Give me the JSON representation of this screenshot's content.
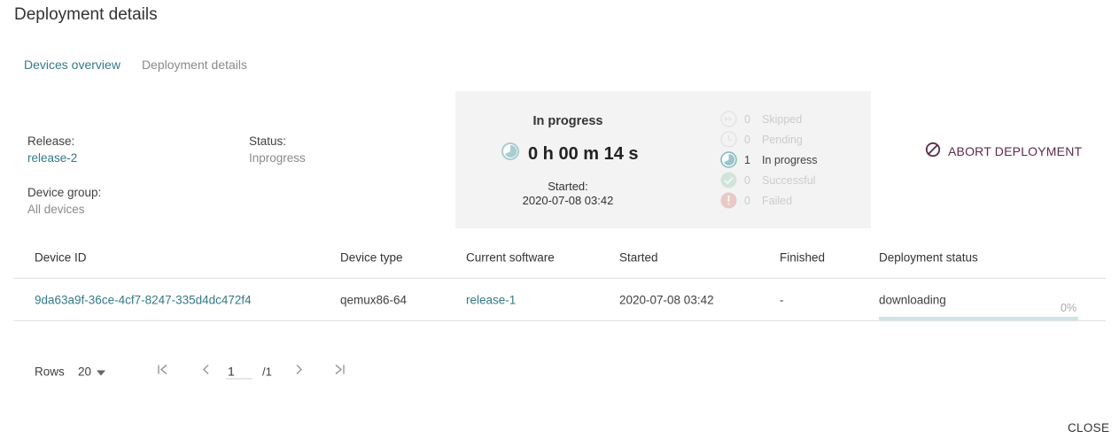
{
  "dialog": {
    "title": "Deployment details",
    "close_label": "CLOSE"
  },
  "tabs": [
    {
      "label": "Devices overview",
      "active": true
    },
    {
      "label": "Deployment details",
      "active": false
    }
  ],
  "summary": {
    "release_label": "Release:",
    "release_value": "release-2",
    "status_label": "Status:",
    "status_value": "Inprogress",
    "group_label": "Device group:",
    "group_value": "All devices"
  },
  "progress": {
    "title": "In progress",
    "timer": "0 h 00 m 14 s",
    "started_label": "Started:",
    "started_value": "2020-07-08 03:42",
    "phases": [
      {
        "count": "0",
        "label": "Skipped",
        "icon": "skipped-icon",
        "active": false,
        "color": "#b0b0b0"
      },
      {
        "count": "0",
        "label": "Pending",
        "icon": "pending-icon",
        "active": false,
        "color": "#b0b0b0"
      },
      {
        "count": "1",
        "label": "In progress",
        "icon": "in-progress-icon",
        "active": true,
        "color": "#7fb7bd"
      },
      {
        "count": "0",
        "label": "Successful",
        "icon": "check-icon",
        "active": false,
        "color": "#5cb08a"
      },
      {
        "count": "0",
        "label": "Failed",
        "icon": "alert-icon",
        "active": false,
        "color": "#c0392b"
      }
    ]
  },
  "abort": {
    "label": "ABORT DEPLOYMENT",
    "icon": "block-icon",
    "color": "#5b2a4a"
  },
  "table": {
    "columns": [
      "Device ID",
      "Device type",
      "Current software",
      "Started",
      "Finished",
      "Deployment status"
    ],
    "rows": [
      {
        "device_id": "9da63a9f-36ce-4cf7-8247-335d4dc472f4",
        "device_type": "qemux86-64",
        "current_software": "release-1",
        "started": "2020-07-08 03:42",
        "finished": "-",
        "status": "downloading",
        "percent_label": "0%",
        "progress_fraction": 0.0
      }
    ]
  },
  "pagination": {
    "rows_label": "Rows",
    "rows_value": "20",
    "page_value": "1",
    "total_pages": "/1"
  },
  "colors": {
    "accent": "#347a87",
    "panel_bg": "#f3f3f3"
  }
}
